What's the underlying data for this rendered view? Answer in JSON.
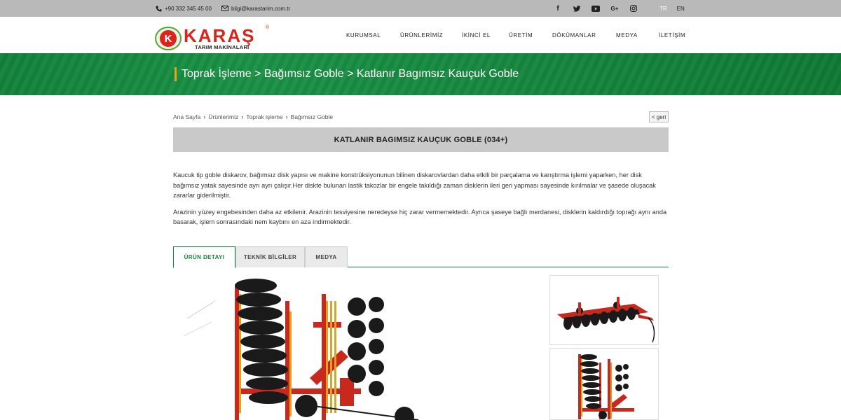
{
  "topbar": {
    "phone": "+90 332 345 45 00",
    "email": "bilgi@karastarim.com.tr",
    "social": [
      {
        "icon": "facebook-icon",
        "glyph": "f"
      },
      {
        "icon": "twitter-icon",
        "glyph": "t"
      },
      {
        "icon": "youtube-icon",
        "glyph": "▶"
      },
      {
        "icon": "google-plus-icon",
        "glyph": "G+"
      },
      {
        "icon": "instagram-icon",
        "glyph": "◎"
      }
    ],
    "languages": [
      {
        "label": "TR",
        "active": true
      },
      {
        "label": "EN",
        "active": false
      }
    ]
  },
  "logo": {
    "brand": "KARAŞ",
    "badge_letter": "K",
    "subtitle": "TARIM MAKİNALARI",
    "registered": "®"
  },
  "nav": {
    "items": [
      "KURUMSAL",
      "ÜRÜNLERİMİZ",
      "İKİNCİ EL",
      "ÜRETİM",
      "DÖKÜMANLAR",
      "MEDYA",
      "İLETİŞİM"
    ]
  },
  "banner": {
    "title": "Toprak İşleme > Bağımsız Goble > Katlanır Bagımsız Kauçuk Goble"
  },
  "breadcrumb": {
    "items": [
      "Ana Sayfa",
      "Ürünlerimiz",
      "Toprak işleme",
      "Bağımsız Goble"
    ],
    "back_label": "< geri"
  },
  "product": {
    "title": "KATLANIR BAGIMSIZ KAUÇUK GOBLE (034+)",
    "description": [
      "Kaucuk tip goble diskarov, bağımsız disk yapısı ve makine konstrüksiyonunun bilinen diskarovlardan daha etkili bir parçalama ve karıştırma işlemi yaparken, her disk bağımsız yatak sayesinde ayrı ayrı çalışır.Her diskte bulunan lastik takozlar bir engele takıldığı zaman disklerin ileri geri yapması sayesinde kırılmalar ve şasede oluşacak zararlar giderilmiştir.",
      "Arazinin yüzey engebesinden daha az etkilenir. Arazinin tesviyesine neredeyse hiç zarar vermemektedir. Ayrıca şaseye bağlı merdanesi, disklerin kaldırdığı toprağı aynı anda basarak, işlem sonrasındaki nem kaybını en aza indirmektedir."
    ]
  },
  "tabs": [
    {
      "label": "ÜRÜN DETAYI",
      "active": true
    },
    {
      "label": "TEKNİK BİLGİLER",
      "active": false
    },
    {
      "label": "MEDYA",
      "active": false
    }
  ],
  "colors": {
    "brand_red": "#d9251c",
    "brand_green": "#14823c",
    "accent_orange": "#e5a320"
  }
}
